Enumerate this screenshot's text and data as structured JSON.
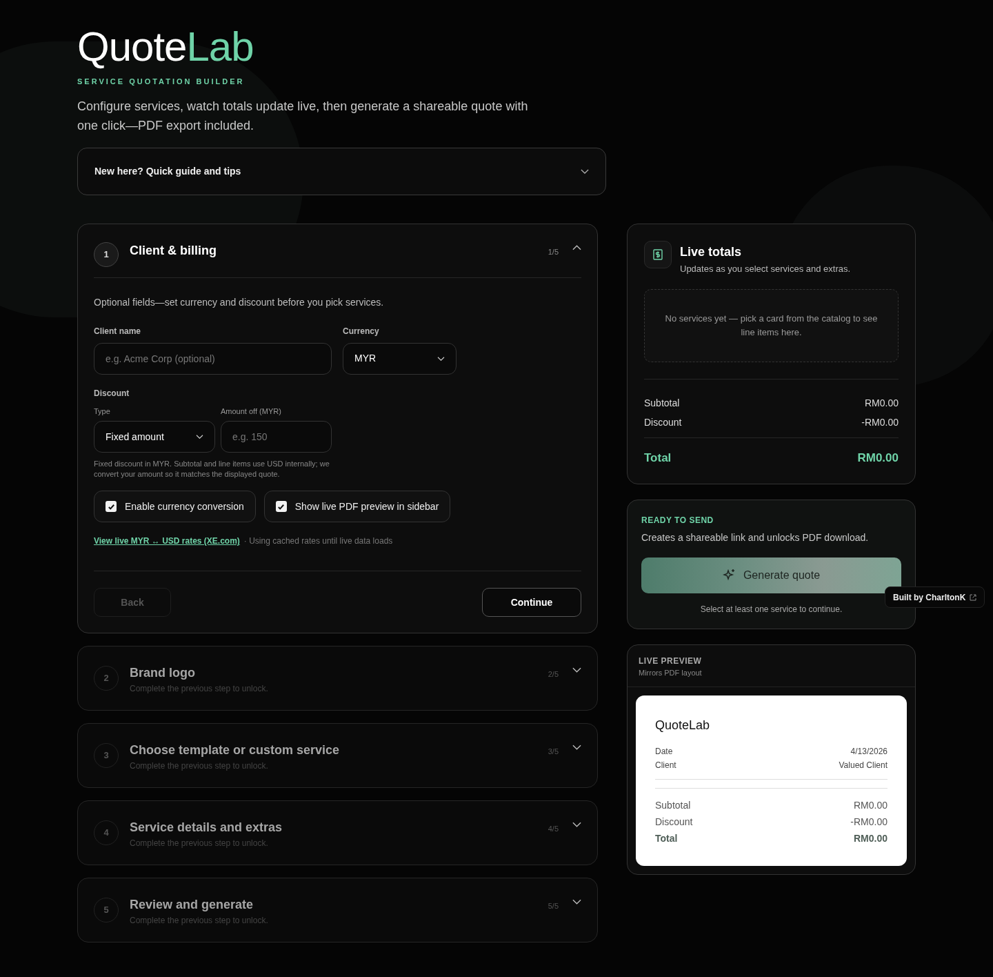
{
  "brand": {
    "name_start": "Quote",
    "name_end": "Lab",
    "tagline": "SERVICE QUOTATION BUILDER",
    "intro": "Configure services, watch totals update live, then generate a shareable quote with one click—PDF export included."
  },
  "guide": {
    "label": "New here? Quick guide and tips",
    "expanded": false
  },
  "steps": [
    {
      "number": "1",
      "title": "Client & billing",
      "progress": "1/5",
      "expanded": true,
      "locked": false
    },
    {
      "number": "2",
      "title": "Brand logo",
      "subtitle": "Complete the previous step to unlock.",
      "progress": "2/5",
      "expanded": false,
      "locked": true
    },
    {
      "number": "3",
      "title": "Choose template or custom service",
      "subtitle": "Complete the previous step to unlock.",
      "progress": "3/5",
      "expanded": false,
      "locked": true
    },
    {
      "number": "4",
      "title": "Service details and extras",
      "subtitle": "Complete the previous step to unlock.",
      "progress": "4/5",
      "expanded": false,
      "locked": true
    },
    {
      "number": "5",
      "title": "Review and generate",
      "subtitle": "Complete the previous step to unlock.",
      "progress": "5/5",
      "expanded": false,
      "locked": true
    }
  ],
  "billing": {
    "intro": "Optional fields—set currency and discount before you pick services.",
    "client_name": {
      "label": "Client name",
      "placeholder": "e.g. Acme Corp (optional)"
    },
    "currency": {
      "label": "Currency",
      "value": "MYR"
    },
    "discount": {
      "heading": "Discount",
      "type_label": "Type",
      "type_value": "Fixed amount",
      "amount_label": "Amount off (MYR)",
      "amount_placeholder": "e.g. 150",
      "note": "Fixed discount in MYR. Subtotal and line items use USD internally; we convert your amount so it matches the displayed quote."
    },
    "toggles": [
      {
        "label": "Enable currency conversion",
        "checked": true
      },
      {
        "label": "Show live PDF preview in sidebar",
        "checked": true
      }
    ],
    "rates_link": "View live MYR ↔ USD rates (XE.com)",
    "rates_note": "· Using cached rates until live data loads",
    "buttons": [
      {
        "label": "Back",
        "kind": "secondary",
        "disabled": true
      },
      {
        "label": "Continue",
        "kind": "primary",
        "disabled": false
      }
    ]
  },
  "totals": {
    "title": "Live totals",
    "subtitle": "Updates as you select services and extras.",
    "empty": "No services yet — pick a card from the catalog to see line items here.",
    "rows": [
      {
        "label": "Subtotal",
        "value": "RM0.00",
        "kind": "line"
      },
      {
        "label": "Discount",
        "value": "-RM0.00",
        "kind": "line"
      },
      {
        "label": "Total",
        "value": "RM0.00",
        "kind": "total"
      }
    ]
  },
  "send": {
    "eyebrow": "READY TO SEND",
    "description": "Creates a shareable link and unlocks PDF download.",
    "button": "Generate quote",
    "disabled": true,
    "hint": "Select at least one service to continue."
  },
  "preview": {
    "eyebrow": "LIVE PREVIEW",
    "subtitle": "Mirrors PDF layout",
    "doc_title": "QuoteLab",
    "meta": [
      {
        "label": "Date",
        "value": "4/13/2026"
      },
      {
        "label": "Client",
        "value": "Valued Client"
      }
    ],
    "rows": [
      {
        "label": "Subtotal",
        "value": "RM0.00",
        "kind": "line"
      },
      {
        "label": "Discount",
        "value": "-RM0.00",
        "kind": "line"
      },
      {
        "label": "Total",
        "value": "RM0.00",
        "kind": "total"
      }
    ]
  },
  "credit": "Built by CharltonK"
}
